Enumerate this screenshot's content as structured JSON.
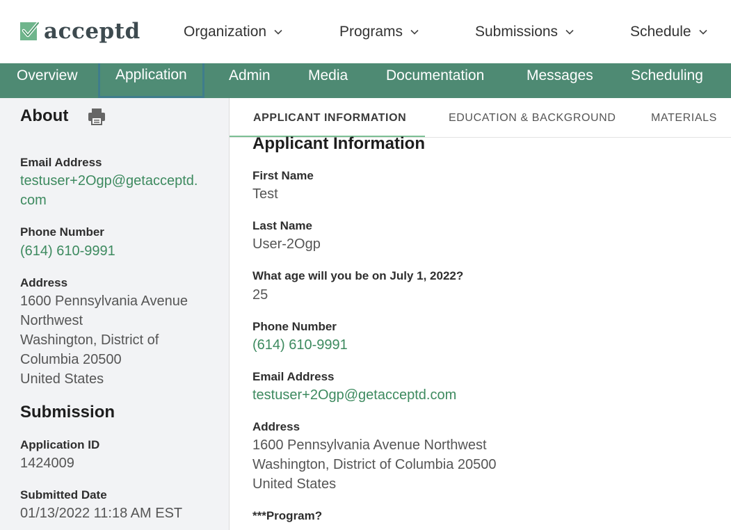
{
  "brand": {
    "name": "acceptd"
  },
  "topnav": {
    "items": [
      {
        "label": "Organization"
      },
      {
        "label": "Programs"
      },
      {
        "label": "Submissions"
      },
      {
        "label": "Schedule"
      }
    ]
  },
  "tabs": {
    "items": [
      {
        "label": "Overview"
      },
      {
        "label": "Application"
      },
      {
        "label": "Admin"
      },
      {
        "label": "Media"
      },
      {
        "label": "Documentation"
      },
      {
        "label": "Messages"
      },
      {
        "label": "Scheduling"
      }
    ],
    "active": "Application"
  },
  "sidebar": {
    "about_title": "About",
    "email_label": "Email Address",
    "email_line1": "testuser+2Ogp@getacceptd.",
    "email_line2": "com",
    "phone_label": "Phone Number",
    "phone": "(614) 610-9991",
    "address_label": "Address",
    "address_lines": [
      "1600 Pennsylvania Avenue",
      "Northwest",
      "Washington, District of",
      "Columbia 20500",
      "United States"
    ],
    "submission_title": "Submission",
    "app_id_label": "Application ID",
    "app_id": "1424009",
    "submitted_label": "Submitted Date",
    "submitted": "01/13/2022 11:18 AM EST"
  },
  "subtabs": {
    "items": [
      {
        "label": "APPLICANT INFORMATION"
      },
      {
        "label": "EDUCATION & BACKGROUND"
      },
      {
        "label": "MATERIALS"
      }
    ],
    "active": "APPLICANT INFORMATION"
  },
  "applicant": {
    "title": "Applicant Information",
    "first_name_label": "First Name",
    "first_name": "Test",
    "last_name_label": "Last Name",
    "last_name": "User-2Ogp",
    "age_label": "What age will you be on July 1, 2022?",
    "age": "25",
    "phone_label": "Phone Number",
    "phone": "(614) 610-9991",
    "email_label": "Email Address",
    "email": "testuser+2Ogp@getacceptd.com",
    "address_label": "Address",
    "address_lines": [
      "1600 Pennsylvania Avenue Northwest",
      "Washington, District of Columbia 20500",
      "United States"
    ],
    "program_label": "***Program?"
  },
  "colors": {
    "brand_green": "#4e8a73",
    "link_green": "#3d8a5f",
    "active_tab_border": "#3f7d8c",
    "sidebar_bg": "#f2f3f5"
  },
  "icons": [
    "check-logo-icon",
    "chevron-down-icon",
    "printer-icon"
  ]
}
